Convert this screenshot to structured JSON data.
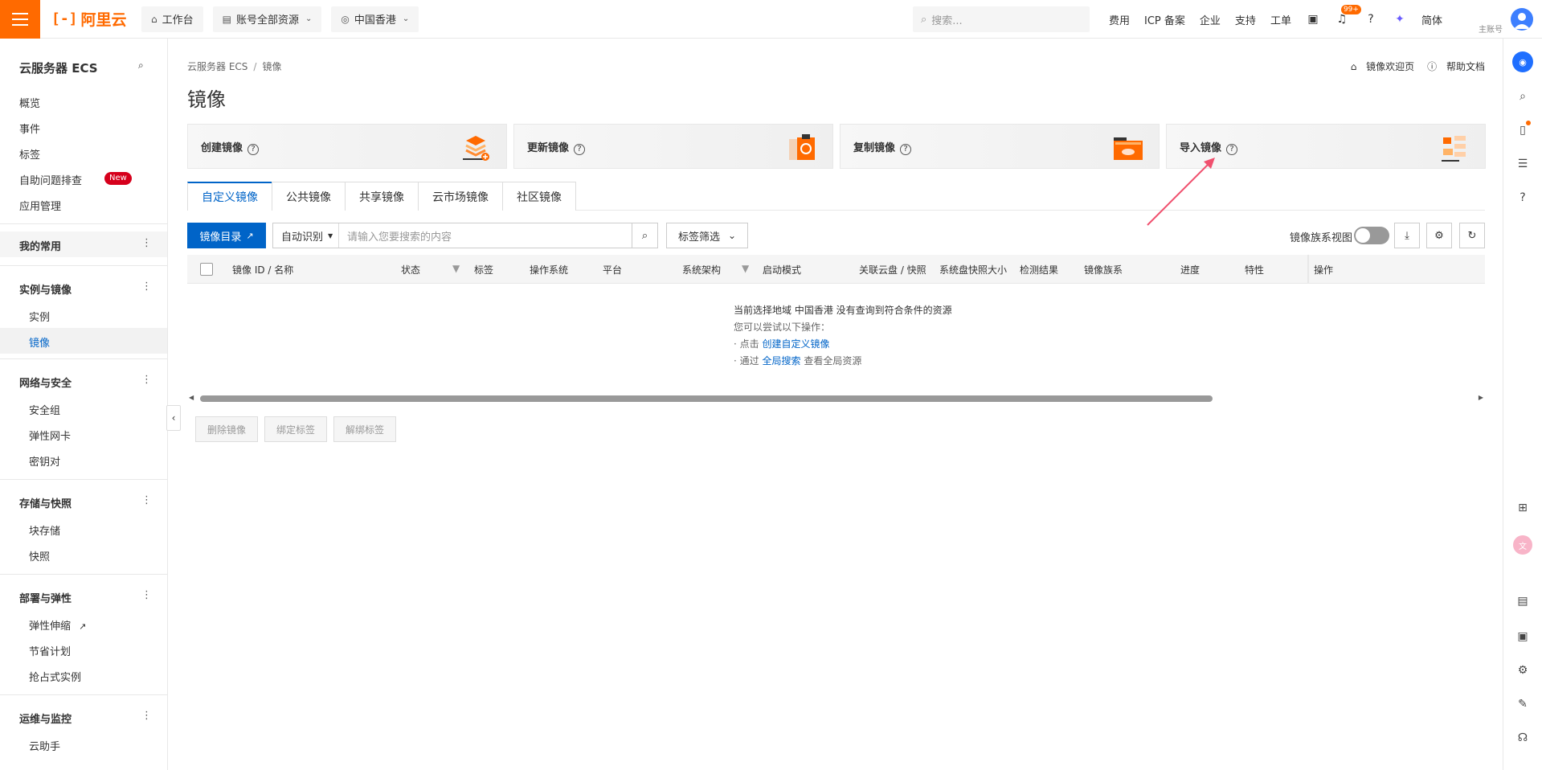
{
  "topbar": {
    "logo_text": "阿里云",
    "workbench": "工作台",
    "account_scope": "账号全部资源",
    "region": "中国香港",
    "search_placeholder": "搜索...",
    "nav": [
      "费用",
      "ICP 备案",
      "企业",
      "支持",
      "工单"
    ],
    "notification_badge": "99+",
    "language": "简体",
    "account_label": "主账号"
  },
  "sidebar": {
    "title": "云服务器 ECS",
    "top_items": [
      "概览",
      "事件",
      "标签",
      "自助问题排查",
      "应用管理"
    ],
    "new_badge": "New",
    "favorites": "我的常用",
    "groups": [
      {
        "title": "实例与镜像",
        "items": [
          "实例",
          "镜像"
        ]
      },
      {
        "title": "网络与安全",
        "items": [
          "安全组",
          "弹性网卡",
          "密钥对"
        ]
      },
      {
        "title": "存储与快照",
        "items": [
          "块存储",
          "快照"
        ]
      },
      {
        "title": "部署与弹性",
        "items": [
          "弹性伸缩",
          "节省计划",
          "抢占式实例"
        ]
      },
      {
        "title": "运维与监控",
        "items": [
          "云助手"
        ]
      }
    ]
  },
  "main": {
    "breadcrumb": [
      "云服务器 ECS",
      "镜像"
    ],
    "page_title": "镜像",
    "head_links": [
      "镜像欢迎页",
      "帮助文档"
    ],
    "cards": [
      "创建镜像",
      "更新镜像",
      "复制镜像",
      "导入镜像"
    ],
    "tabs": [
      "自定义镜像",
      "公共镜像",
      "共享镜像",
      "云市场镜像",
      "社区镜像"
    ],
    "toolbar": {
      "catalog_button": "镜像目录",
      "search_mode": "自动识别",
      "search_placeholder": "请输入您要搜索的内容",
      "tag_filter": "标签筛选",
      "family_view": "镜像族系视图"
    },
    "columns": [
      "镜像 ID / 名称",
      "状态",
      "标签",
      "操作系统",
      "平台",
      "系统架构",
      "启动模式",
      "关联云盘 / 快照",
      "系统盘快照大小",
      "检测结果",
      "镜像族系",
      "进度",
      "特性",
      "操作"
    ],
    "empty": {
      "line1": "当前选择地域 中国香港 没有查询到符合条件的资源",
      "line2": "您可以尝试以下操作：",
      "line3_prefix": "· 点击",
      "line3_link": "创建自定义镜像",
      "line4_prefix": "· 通过",
      "line4_link": "全局搜索",
      "line4_suffix": "查看全局资源"
    },
    "bottom_buttons": [
      "删除镜像",
      "绑定标签",
      "解绑标签"
    ]
  },
  "colors": {
    "brand": "#ff6a00",
    "primary": "#0064c8",
    "annotation_arrow": "#f0506e"
  }
}
